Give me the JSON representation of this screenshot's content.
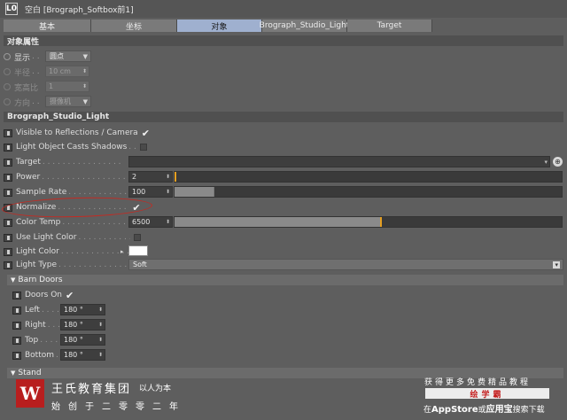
{
  "window": {
    "title_logo": "L0",
    "title": "空白 [Brograph_Softbox前1]"
  },
  "tabs": [
    {
      "label": "基本",
      "active": false
    },
    {
      "label": "坐标",
      "active": false
    },
    {
      "label": "对象",
      "active": true
    },
    {
      "label": "Brograph_Studio_Light",
      "active": false
    },
    {
      "label": "Target",
      "active": false
    }
  ],
  "object_props": {
    "header": "对象属性",
    "display": {
      "label": "显示",
      "value": "圆点"
    },
    "radius": {
      "label": "半径",
      "value": "10 cm"
    },
    "aspect": {
      "label": "宽高比",
      "value": "1"
    },
    "direction": {
      "label": "方向",
      "value": "摄像机"
    }
  },
  "studio_light": {
    "header": "Brograph_Studio_Light",
    "visible_reflections": {
      "label": "Visible to Reflections / Camera",
      "checked": "✔"
    },
    "casts_shadows": {
      "label": "Light Object Casts Shadows"
    },
    "target": {
      "label": "Target"
    },
    "power": {
      "label": "Power",
      "value": "2",
      "slider": 0.0
    },
    "sample_rate": {
      "label": "Sample Rate",
      "value": "100",
      "slider": 0.1
    },
    "normalize": {
      "label": "Normalize",
      "checked": "✔"
    },
    "color_temp": {
      "label": "Color Temp",
      "value": "6500",
      "slider": 0.53
    },
    "use_light_color": {
      "label": "Use Light Color"
    },
    "light_color": {
      "label": "Light Color",
      "color": "#ffffff"
    },
    "light_type": {
      "label": "Light Type",
      "value": "Soft"
    }
  },
  "barn_doors": {
    "header": "Barn Doors",
    "doors_on": {
      "label": "Doors On",
      "checked": "✔"
    },
    "left": {
      "label": "Left",
      "value": "180 °"
    },
    "right": {
      "label": "Right",
      "value": "180 °"
    },
    "top": {
      "label": "Top",
      "value": "180 °"
    },
    "bottom": {
      "label": "Bottom",
      "value": "180 °"
    }
  },
  "stand": {
    "header": "Stand"
  },
  "watermark": {
    "logo_letter": "W",
    "brand": "王氏教育集团",
    "motto": "以人为本",
    "founded": "始创于二零零二年",
    "promo_top": "获得更多免费精品教程",
    "promo_tag": "绘学霸",
    "promo_bottom_prefix": "在",
    "promo_appstore": "AppStore",
    "promo_or": "或",
    "promo_yyb": "应用宝",
    "promo_bottom_suffix": "搜索下载"
  },
  "colors": {
    "tab_active": "#9fb0cf",
    "slider_handle": "#e59f22",
    "highlight_ring": "#c42a22",
    "logo_red": "#b81e1e"
  }
}
